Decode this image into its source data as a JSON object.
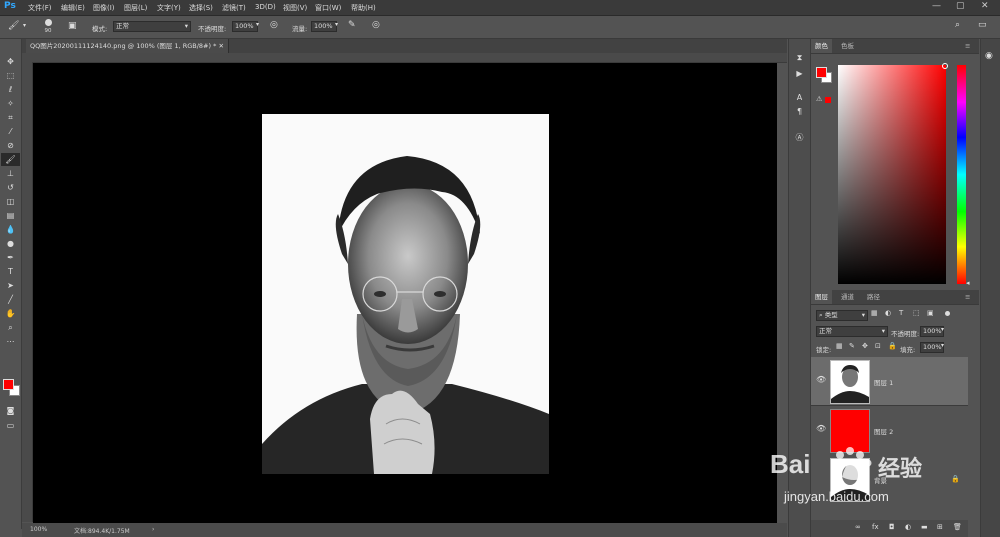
{
  "menubar": {
    "app_logo": "Ps",
    "items": [
      "文件(F)",
      "编辑(E)",
      "图像(I)",
      "图层(L)",
      "文字(Y)",
      "选择(S)",
      "滤镜(T)",
      "3D(D)",
      "视图(V)",
      "窗口(W)",
      "帮助(H)"
    ]
  },
  "options": {
    "brush_size": "90",
    "mode_label": "模式:",
    "mode_value": "正常",
    "opacity_label": "不透明度:",
    "opacity_value": "100%",
    "flow_label": "流量:",
    "flow_value": "100%"
  },
  "document": {
    "tab_title": "QQ图片20200111124140.png @ 100% (图层 1, RGB/8#) *",
    "zoom": "100%",
    "doc_info": "文档:894.4K/1.75M"
  },
  "color_panel": {
    "tabs": [
      "颜色",
      "色板"
    ],
    "foreground": "#ff0000",
    "background": "#ffffff"
  },
  "layers_panel": {
    "tabs": [
      "图层",
      "通道",
      "路径"
    ],
    "filter_label": "类型",
    "blend_mode": "正常",
    "opacity_label": "不透明度:",
    "opacity_value": "100%",
    "lock_label": "锁定:",
    "fill_label": "填充:",
    "fill_value": "100%",
    "layers": [
      {
        "name": "图层 1"
      },
      {
        "name": "图层 2"
      },
      {
        "name": "背景"
      }
    ]
  },
  "watermark": {
    "brand": "Bai",
    "brand2": "经验",
    "url": "jingyan.baidu.com"
  },
  "colors": {
    "accent": "#31a8ff",
    "red": "#ff0000",
    "canvas": "#000000"
  }
}
